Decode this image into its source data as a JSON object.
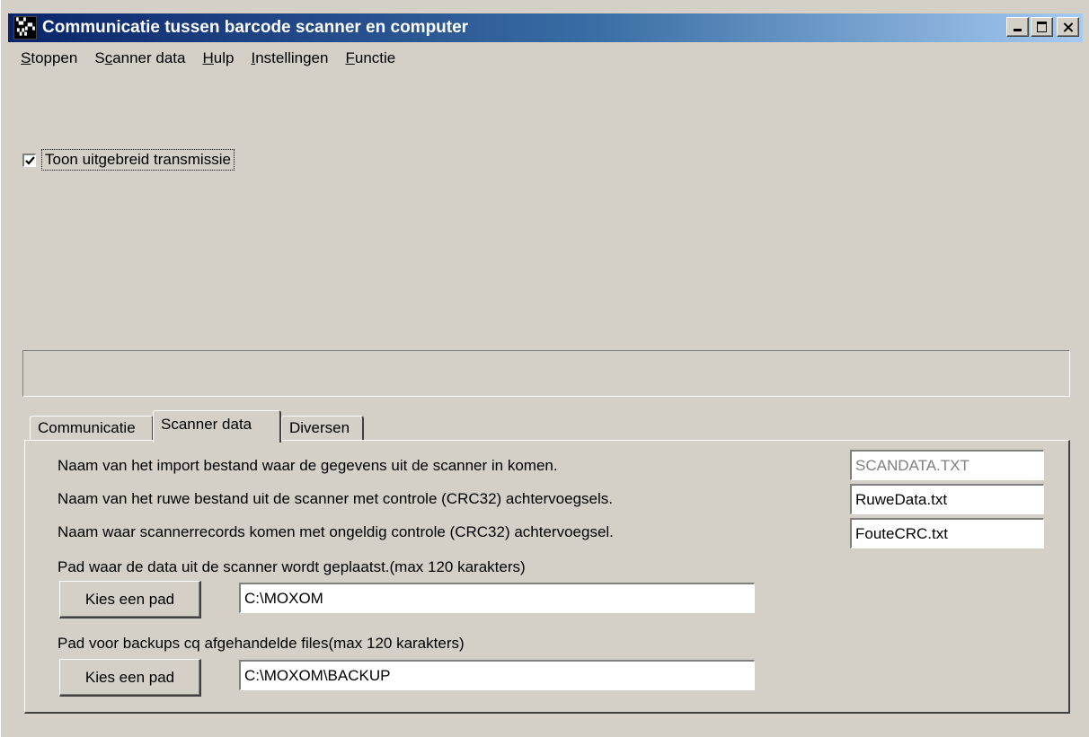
{
  "window": {
    "title": "Communicatie tussen barcode scanner en computer"
  },
  "menu": {
    "items": [
      {
        "u": "S",
        "rest": "toppen"
      },
      {
        "pre": "S",
        "u": "c",
        "rest": "anner data"
      },
      {
        "u": "H",
        "rest": "ulp"
      },
      {
        "u": "I",
        "rest": "nstellingen"
      },
      {
        "u": "F",
        "rest": "unctie"
      }
    ]
  },
  "options": {
    "show_extended_label": "Toon uitgebreid transmissie",
    "show_extended_checked": true
  },
  "tabs": {
    "communicatie": "Communicatie",
    "scanner_data": "Scanner data",
    "diversen": "Diversen",
    "active": "scanner_data"
  },
  "scanner_data": {
    "import_label": "Naam van het import bestand waar de gegevens uit de scanner in komen.",
    "import_value": "SCANDATA.TXT",
    "raw_label": "Naam van het ruwe bestand uit de scanner met controle (CRC32) achtervoegsels.",
    "raw_value": "RuweData.txt",
    "bad_label": "Naam waar scannerrecords komen met ongeldig controle (CRC32) achtervoegsel.",
    "bad_value": "FouteCRC.txt",
    "data_path_label": "Pad waar de data uit de scanner wordt geplaatst.(max 120 karakters)",
    "data_path_button": "Kies een pad",
    "data_path_value": "C:\\MOXOM",
    "backup_path_label": "Pad voor backups cq afgehandelde files(max 120 karakters)",
    "backup_path_button": "Kies een pad",
    "backup_path_value": "C:\\MOXOM\\BACKUP"
  }
}
